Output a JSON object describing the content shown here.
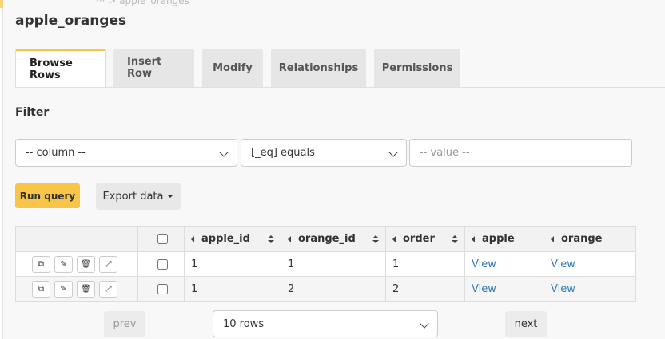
{
  "header": {
    "breadcrumb_ghost": "···  > apple_oranges",
    "table_name": "apple_oranges"
  },
  "tabs": [
    {
      "label": "Browse Rows",
      "active": true
    },
    {
      "label": "Insert Row",
      "active": false
    },
    {
      "label": "Modify",
      "active": false
    },
    {
      "label": "Relationships",
      "active": false
    },
    {
      "label": "Permissions",
      "active": false
    }
  ],
  "filter": {
    "label": "Filter",
    "column_select": "-- column --",
    "operator_select": "[_eq] equals",
    "value_placeholder": "-- value --"
  },
  "actions": {
    "run_query": "Run query",
    "export_data": "Export data"
  },
  "table": {
    "columns": [
      "apple_id",
      "orange_id",
      "order",
      "apple",
      "orange"
    ],
    "rows": [
      {
        "apple_id": "1",
        "orange_id": "1",
        "order": "1",
        "apple": "View",
        "orange": "View"
      },
      {
        "apple_id": "1",
        "orange_id": "2",
        "order": "2",
        "apple": "View",
        "orange": "View"
      }
    ]
  },
  "pagination": {
    "prev": "prev",
    "next": "next",
    "rows_per_page": "10 rows"
  },
  "colors": {
    "accent": "#f7c548",
    "link": "#337ab7"
  },
  "icons": {
    "clone": "clone-icon",
    "edit": "edit-icon",
    "delete": "trash-icon",
    "expand": "expand-icon"
  }
}
